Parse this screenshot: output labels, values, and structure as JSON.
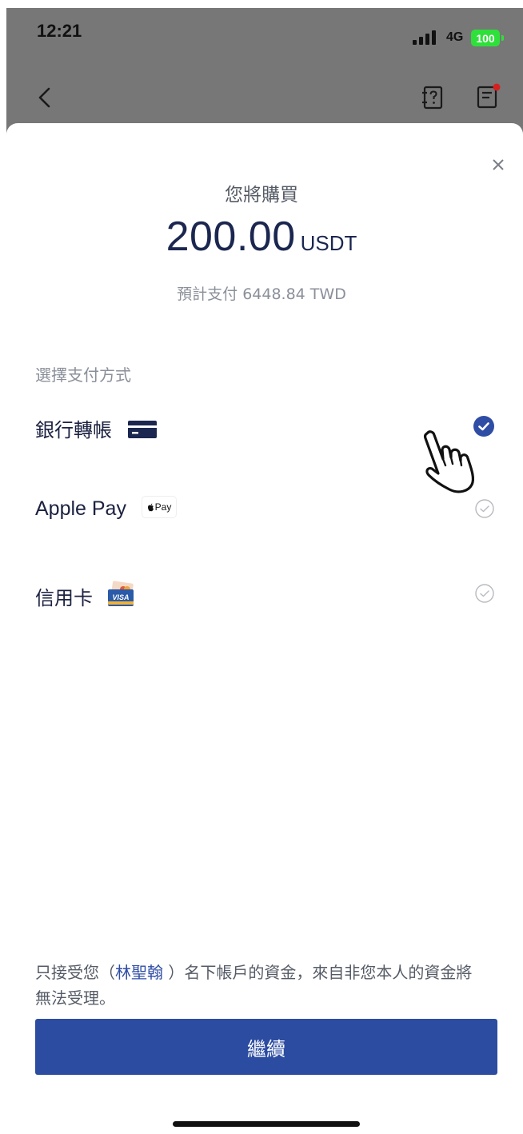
{
  "status_bar": {
    "time": "12:21",
    "network": "4G",
    "battery": "100"
  },
  "purchase": {
    "label": "您將購買",
    "amount": "200.00",
    "unit": "USDT",
    "estimate": "預計支付 6448.84 TWD"
  },
  "payment": {
    "section_title": "選擇支付方式",
    "options": [
      {
        "label": "銀行轉帳",
        "selected": true,
        "icon": "bank-card-icon"
      },
      {
        "label": "Apple Pay",
        "selected": false,
        "icon": "apple-pay-icon",
        "badge": "Pay"
      },
      {
        "label": "信用卡",
        "selected": false,
        "icon": "credit-card-visa-icon"
      }
    ]
  },
  "notice": {
    "before": "只接受您（",
    "name": "林聖翰",
    "after": " ）名下帳戶的資金，來自非您本人的資金將無法受理。"
  },
  "continue_label": "繼續",
  "colors": {
    "primary": "#2c4ca1",
    "text_dark": "#1b2750",
    "muted": "#8a8f99",
    "battery": "#2ee03a"
  }
}
